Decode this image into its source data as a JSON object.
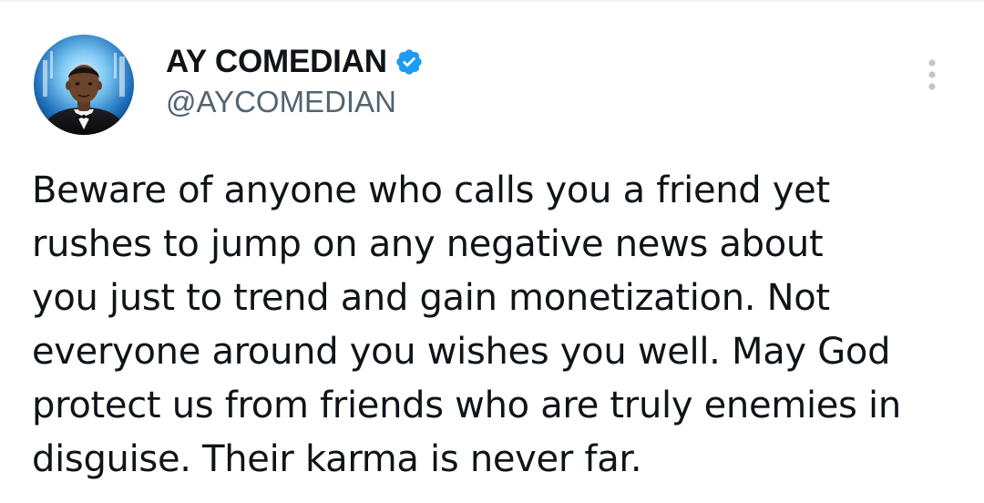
{
  "tweet": {
    "author": {
      "display_name": "AY COMEDIAN",
      "handle": "@AYCOMEDIAN",
      "verified": true,
      "avatar_icon": "profile-photo-avatar"
    },
    "text": "Beware of anyone who calls you a friend yet\nrushes to jump on any negative news about\nyou just to trend and gain monetization. Not\neveryone around you wishes you well. May God\nprotect us from friends who are truly enemies in\ndisguise. Their karma is never far.",
    "more_icon": "more-vertical-icon"
  },
  "colors": {
    "text_primary": "#0f1419",
    "text_secondary": "#536471",
    "verified_blue": "#1d9bf0",
    "more_icon": "#bfc6cc"
  }
}
